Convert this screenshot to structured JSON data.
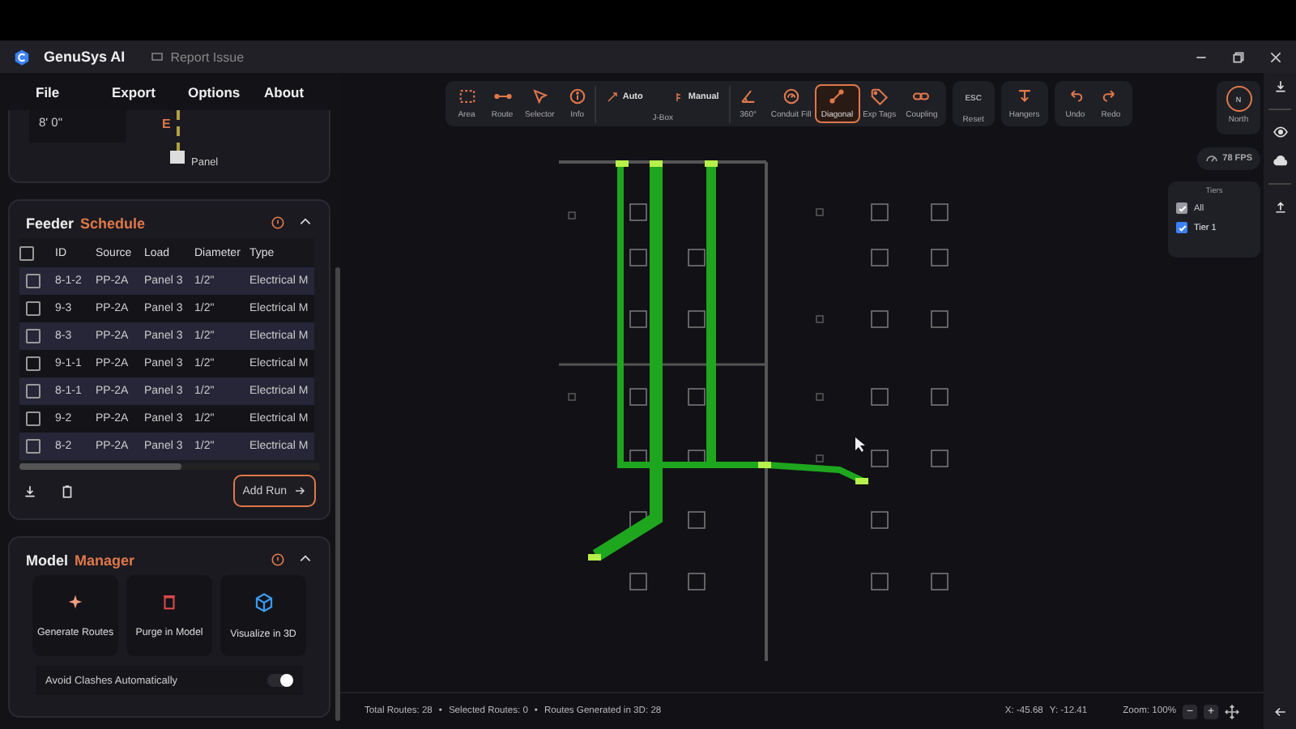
{
  "title_bar": {
    "app_name": "GenuSys AI",
    "report_link": "Report Issue"
  },
  "menu": [
    "File",
    "Export",
    "Options",
    "About"
  ],
  "elevation_panel": {
    "height_value": "8' 0\"",
    "marker": "E",
    "panel_label": "Panel"
  },
  "feeder_schedule": {
    "title": "Feeder",
    "title_accent": "Schedule",
    "header_checked": false,
    "columns": [
      "ID",
      "Source",
      "Load",
      "Diameter",
      "Type"
    ],
    "rows": [
      {
        "cells": [
          "8-1-2",
          "PP-2A",
          "Panel 3",
          "1/2\"",
          "Electrical M"
        ],
        "checked": false
      },
      {
        "cells": [
          "9-3",
          "PP-2A",
          "Panel 3",
          "1/2\"",
          "Electrical M"
        ],
        "checked": false
      },
      {
        "cells": [
          "8-3",
          "PP-2A",
          "Panel 3",
          "1/2\"",
          "Electrical M"
        ],
        "checked": false
      },
      {
        "cells": [
          "9-1-1",
          "PP-2A",
          "Panel 3",
          "1/2\"",
          "Electrical M"
        ],
        "checked": false
      },
      {
        "cells": [
          "8-1-1",
          "PP-2A",
          "Panel 3",
          "1/2\"",
          "Electrical M"
        ],
        "checked": false
      },
      {
        "cells": [
          "9-2",
          "PP-2A",
          "Panel 3",
          "1/2\"",
          "Electrical M"
        ],
        "checked": false
      },
      {
        "cells": [
          "8-2",
          "PP-2A",
          "Panel 3",
          "1/2\"",
          "Electrical M"
        ],
        "checked": false
      }
    ],
    "add_button": "Add Run"
  },
  "model_manager": {
    "title": "Model",
    "title_accent": "Manager",
    "actions": [
      "Generate Routes",
      "Purge in Model",
      "Visualize in 3D"
    ],
    "toggle": {
      "label": "Avoid Clashes Automatically",
      "on": true
    }
  },
  "toolbar": {
    "groups": [
      {
        "items": [
          {
            "kind": "tool",
            "label": "Area",
            "selected": false
          },
          {
            "kind": "tool",
            "label": "Route",
            "selected": false
          },
          {
            "kind": "tool",
            "label": "Selector",
            "selected": false
          },
          {
            "kind": "tool",
            "label": "Info",
            "selected": false
          },
          {
            "kind": "jbox",
            "caption": "J-Box",
            "options": [
              "Auto",
              "Manual"
            ]
          },
          {
            "kind": "tool",
            "label": "360°",
            "selected": false
          },
          {
            "kind": "tool",
            "label": "Conduit Fill",
            "selected": false
          },
          {
            "kind": "tool",
            "label": "Diagonal",
            "selected": true
          },
          {
            "kind": "tool",
            "label": "Exp Tags",
            "selected": false
          },
          {
            "kind": "tool",
            "label": "Coupling",
            "selected": false
          }
        ]
      },
      {
        "items": [
          {
            "kind": "key",
            "key": "ESC",
            "label": "Reset",
            "selected": false
          }
        ]
      },
      {
        "items": [
          {
            "kind": "tool",
            "label": "Hangers",
            "selected": false
          }
        ]
      },
      {
        "items": [
          {
            "kind": "tool",
            "label": "Undo",
            "selected": false
          },
          {
            "kind": "tool",
            "label": "Redo",
            "selected": false
          }
        ]
      }
    ]
  },
  "compass": {
    "letter": "N",
    "label": "North"
  },
  "fps": "78 FPS",
  "tiers": {
    "title": "Tiers",
    "items": [
      {
        "label": "All",
        "checked": true,
        "disabled": true
      },
      {
        "label": "Tier 1",
        "checked": true,
        "disabled": false
      }
    ]
  },
  "status_bar": {
    "stats": [
      "Total Routes: 28",
      "Selected Routes: 0",
      "Routes Generated in 3D: 28"
    ],
    "separator": "•",
    "x": "X: -45.68",
    "y": "Y: -12.41",
    "zoom": "Zoom: 100%",
    "zoom_out": "−",
    "zoom_in": "+"
  }
}
